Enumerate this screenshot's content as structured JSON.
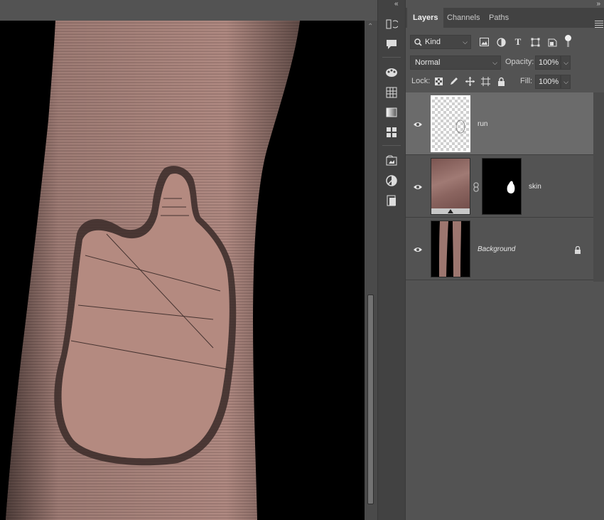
{
  "panel_tabs": [
    "Layers",
    "Channels",
    "Paths"
  ],
  "filter": {
    "kind_label": "Kind"
  },
  "blend": {
    "mode": "Normal",
    "opacity_label": "Opacity:",
    "opacity_value": "100%"
  },
  "lock": {
    "label": "Lock:",
    "fill_label": "Fill:",
    "fill_value": "100%"
  },
  "layers": [
    {
      "name": "run",
      "selected": true,
      "locked": false
    },
    {
      "name": "skin",
      "selected": false,
      "locked": false,
      "has_mask": true
    },
    {
      "name": "Background",
      "selected": false,
      "locked": true
    }
  ],
  "colors": {
    "panel_bg": "#535353",
    "selected_row": "#6b6b6b",
    "skin": "#b48a80"
  }
}
